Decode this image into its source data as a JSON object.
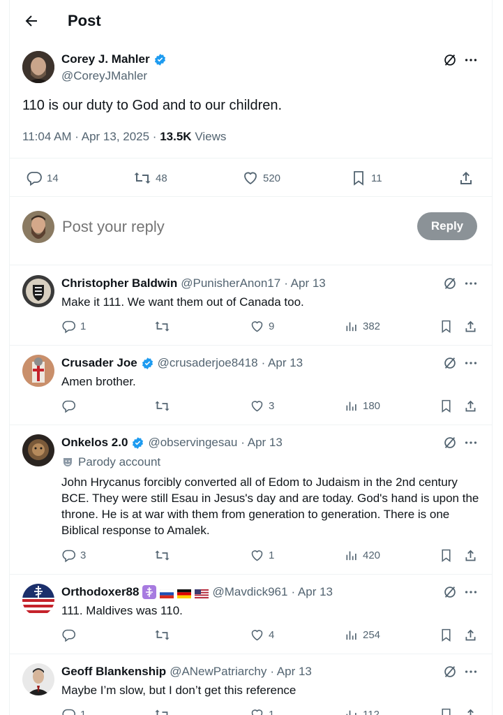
{
  "header": {
    "title": "Post"
  },
  "post": {
    "author_name": "Corey J. Mahler",
    "author_handle": "@CoreyJMahler",
    "text": "110 is our duty to God and to our children.",
    "time": "11:04 AM · Apr 13, 2025 · ",
    "views_count": "13.5K",
    "views_label": "Views",
    "stats": {
      "replies": "14",
      "reposts": "48",
      "likes": "520",
      "bookmarks": "11"
    }
  },
  "composer": {
    "placeholder": "Post your reply",
    "reply_label": "Reply"
  },
  "replies": [
    {
      "name": "Christopher Baldwin",
      "handle": "@PunisherAnon17",
      "date": "· Apr 13",
      "text": "Make it 111. We want them out of Canada too.",
      "replies": "1",
      "reposts": "",
      "likes": "9",
      "views": "382"
    },
    {
      "name": "Crusader Joe",
      "handle": "@crusaderjoe8418",
      "date": "· Apr 13",
      "text": "Amen brother.",
      "replies": "",
      "reposts": "",
      "likes": "3",
      "views": "180"
    },
    {
      "name": "Onkelos 2.0",
      "handle": "@observingesau",
      "date": "· Apr 13",
      "label": "Parody account",
      "text": "John Hrycanus forcibly converted all of Edom to Judaism in the 2nd century BCE.  They were still Esau in Jesus's day and are today.  God's hand is upon the throne.  He is at war with them from generation to generation.  There is one Biblical response to Amalek.",
      "replies": "3",
      "reposts": "",
      "likes": "1",
      "views": "420"
    },
    {
      "name": "Orthodoxer88",
      "handle": "@Mavdick961",
      "date": "· Apr 13",
      "text": "111. Maldives was 110.",
      "replies": "",
      "reposts": "",
      "likes": "4",
      "views": "254"
    },
    {
      "name": "Geoff Blankenship",
      "handle": "@ANewPatriarchy",
      "date": "· Apr 13",
      "text": "Maybe I’m slow, but I don’t get this reference",
      "replies": "1",
      "reposts": "",
      "likes": "1",
      "views": "112"
    }
  ],
  "colors": {
    "verified": "#1d9bf0",
    "grey_text": "#536471",
    "reply_button": "#8b9297"
  }
}
